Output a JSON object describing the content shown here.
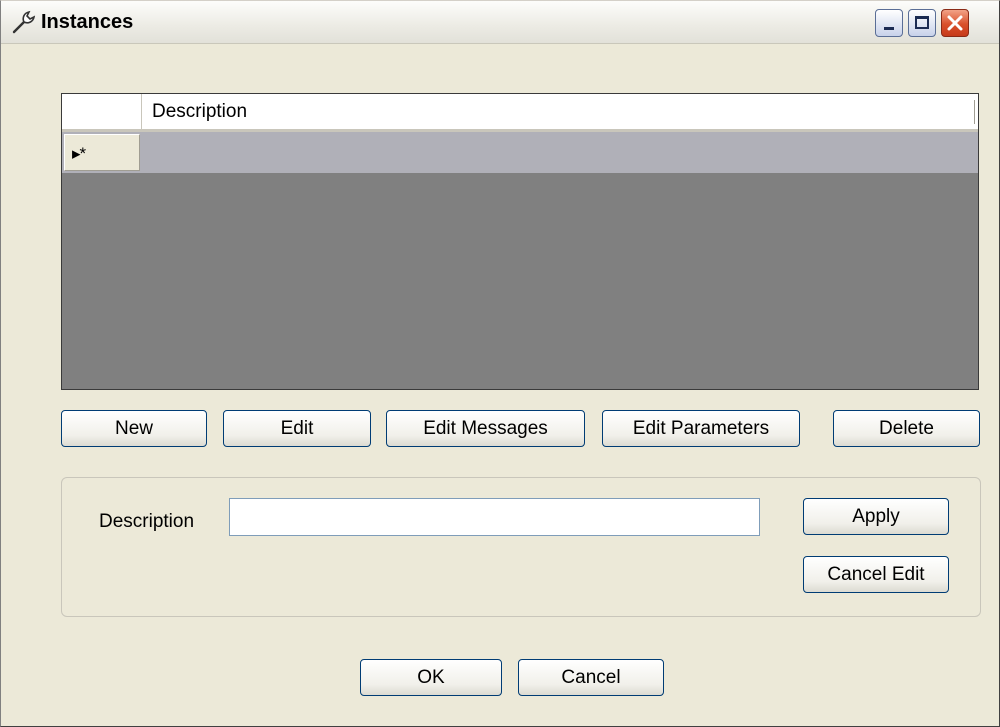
{
  "window": {
    "title": "Instances",
    "title_icon": "wrench-icon"
  },
  "grid": {
    "columns": [
      "Description"
    ],
    "new_row_marker": "▸*",
    "rows": []
  },
  "actions": {
    "new": "New",
    "edit": "Edit",
    "edit_messages": "Edit Messages",
    "edit_parameters": "Edit Parameters",
    "delete": "Delete"
  },
  "editor": {
    "description_label": "Description",
    "description_value": "",
    "apply": "Apply",
    "cancel_edit": "Cancel Edit"
  },
  "dialog": {
    "ok": "OK",
    "cancel": "Cancel"
  },
  "colors": {
    "grid_background": "#808080",
    "new_row_background": "#b0b0b8",
    "close_button": "#d9502b"
  }
}
